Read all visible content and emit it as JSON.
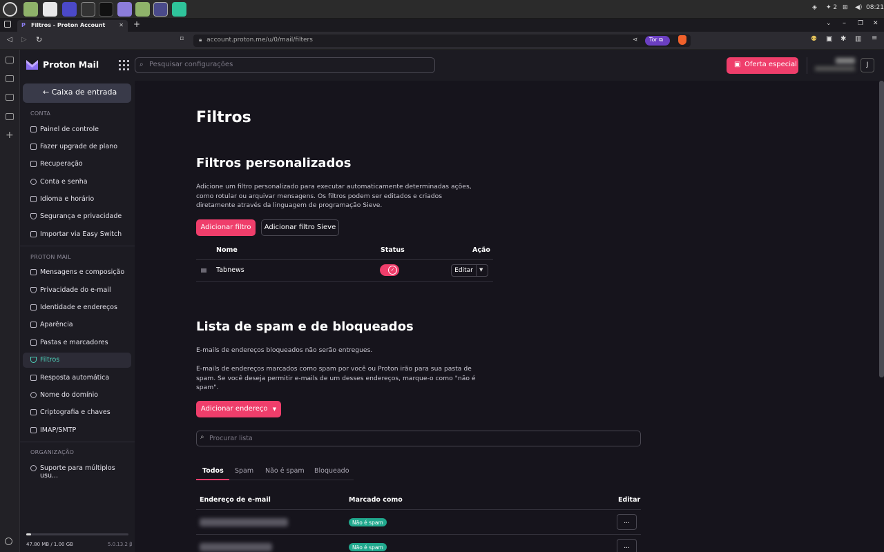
{
  "os_taskbar": {
    "apps": [
      "mint-menu",
      "files",
      "vscode",
      "proton-vpn",
      "keepass",
      "terminal",
      "text-editor",
      "folder",
      "brave",
      "app"
    ],
    "workspace": "2",
    "clock": "08:21"
  },
  "browser": {
    "tab_title": "Filtros - Proton Account",
    "url": "account.proton.me/u/0/mail/filters",
    "tor_label": "Tor",
    "new_tab_symbol": "+"
  },
  "header": {
    "brand": "Proton Mail",
    "search_placeholder": "Pesquisar configurações",
    "offer_label": "Oferta especial",
    "avatar_initial": "J"
  },
  "sidebar": {
    "inbox_label": "← Caixa de entrada",
    "sections": [
      {
        "label": "CONTA",
        "items": [
          "Painel de controle",
          "Fazer upgrade de plano",
          "Recuperação",
          "Conta e senha",
          "Idioma e horário",
          "Segurança e privacidade",
          "Importar via Easy Switch"
        ]
      },
      {
        "label": "PROTON MAIL",
        "items": [
          "Mensagens e composição",
          "Privacidade do e-mail",
          "Identidade e endereços",
          "Aparência",
          "Pastas e marcadores",
          "Filtros",
          "Resposta automática",
          "Nome do domínio",
          "Criptografia e chaves",
          "IMAP/SMTP"
        ]
      },
      {
        "label": "ORGANIZAÇÃO",
        "items": [
          "Suporte para múltiplos usu..."
        ]
      }
    ],
    "active_item": "Filtros",
    "storage_text": "47.80 MB / 1.00 GB",
    "storage_fraction": 0.047,
    "version": "5.0.13.2 β"
  },
  "main": {
    "page_title": "Filtros",
    "custom_filters": {
      "title": "Filtros personalizados",
      "description": "Adicione um filtro personalizado para executar automaticamente determinadas ações, como rotular ou arquivar mensagens. Os filtros podem ser editados e criados diretamente através da linguagem de programação Sieve.",
      "add_filter_label": "Adicionar filtro",
      "add_sieve_label": "Adicionar filtro Sieve",
      "columns": [
        "Nome",
        "Status",
        "Ação"
      ],
      "rows": [
        {
          "name": "Tabnews",
          "enabled": true,
          "action_label": "Editar"
        }
      ]
    },
    "spam": {
      "title": "Lista de spam e de bloqueados",
      "desc1": "E-mails de endereços bloqueados não serão entregues.",
      "desc2": "E-mails de endereços marcados como spam por você ou Proton irão para sua pasta de spam. Se você deseja permitir e-mails de um desses endereços, marque-o como \"não é spam\".",
      "add_address_label": "Adicionar endereço",
      "search_placeholder": "Procurar lista",
      "tabs": [
        "Todos",
        "Spam",
        "Não é spam",
        "Bloqueado"
      ],
      "active_tab": "Todos",
      "columns": [
        "Endereço de e-mail",
        "Marcado como",
        "Editar"
      ],
      "rows": [
        {
          "marked_as": "Não é spam",
          "edit_label": "..."
        },
        {
          "marked_as": "Não é spam",
          "edit_label": "..."
        }
      ]
    }
  },
  "colors": {
    "accent": "#ef3e6b",
    "active_nav": "#4ed4bc",
    "badge_green": "#20a88d"
  }
}
